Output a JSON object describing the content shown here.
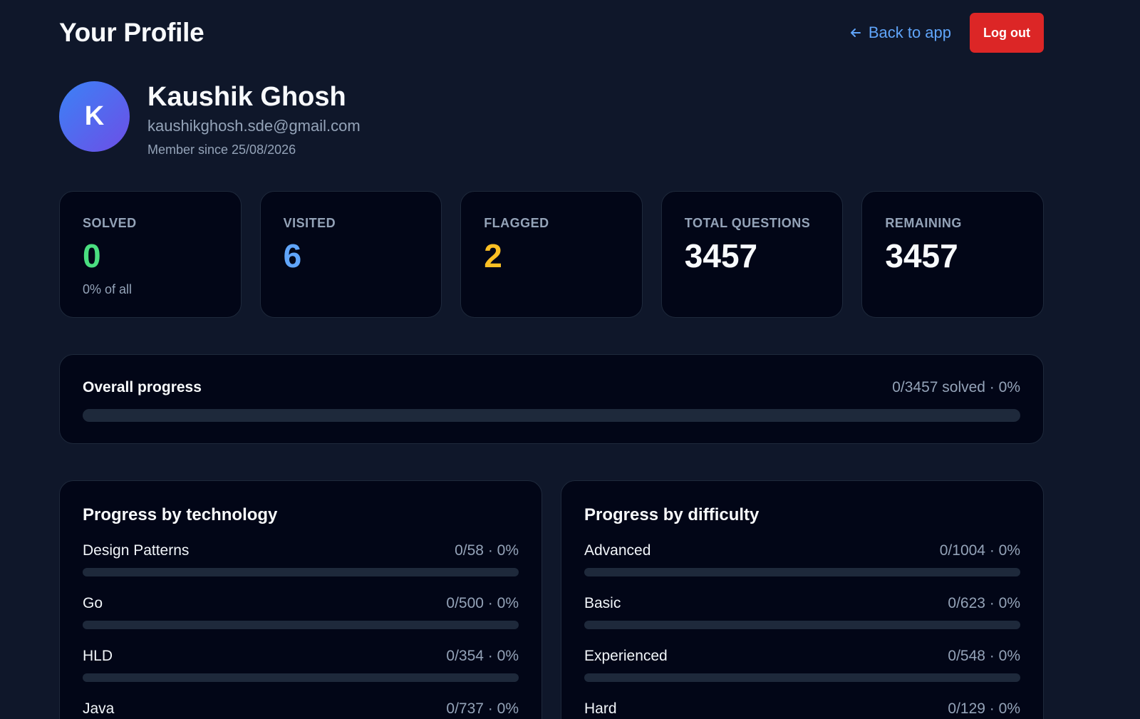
{
  "header": {
    "title": "Your Profile",
    "back_label": "Back to app",
    "logout_label": "Log out"
  },
  "profile": {
    "initial": "K",
    "name": "Kaushik Ghosh",
    "email": "kaushikghosh.sde@gmail.com",
    "member_since": "Member since 25/08/2026"
  },
  "stats": [
    {
      "label": "SOLVED",
      "value": "0",
      "sub": "0% of all",
      "color": "#4ade80"
    },
    {
      "label": "VISITED",
      "value": "6",
      "sub": "",
      "color": "#60a5fa"
    },
    {
      "label": "FLAGGED",
      "value": "2",
      "sub": "",
      "color": "#fbbf24"
    },
    {
      "label": "TOTAL QUESTIONS",
      "value": "3457",
      "sub": "",
      "color": "#f8fafc"
    },
    {
      "label": "REMAINING",
      "value": "3457",
      "sub": "",
      "color": "#f8fafc"
    }
  ],
  "overall": {
    "label": "Overall progress",
    "value_text": "0/3457 solved · 0%",
    "percent": 0
  },
  "technology": {
    "title": "Progress by technology",
    "items": [
      {
        "label": "Design Patterns",
        "value": "0/58 · 0%",
        "percent": 0
      },
      {
        "label": "Go",
        "value": "0/500 · 0%",
        "percent": 0
      },
      {
        "label": "HLD",
        "value": "0/354 · 0%",
        "percent": 0
      },
      {
        "label": "Java",
        "value": "0/737 · 0%",
        "percent": 0
      }
    ]
  },
  "difficulty": {
    "title": "Progress by difficulty",
    "items": [
      {
        "label": "Advanced",
        "value": "0/1004 · 0%",
        "percent": 0
      },
      {
        "label": "Basic",
        "value": "0/623 · 0%",
        "percent": 0
      },
      {
        "label": "Experienced",
        "value": "0/548 · 0%",
        "percent": 0
      },
      {
        "label": "Hard",
        "value": "0/129 · 0%",
        "percent": 0
      }
    ]
  },
  "colors": {
    "background": "#0f172a",
    "card": "#020617",
    "accent": "#60a5fa",
    "danger": "#dc2626",
    "track": "#1e293b"
  }
}
